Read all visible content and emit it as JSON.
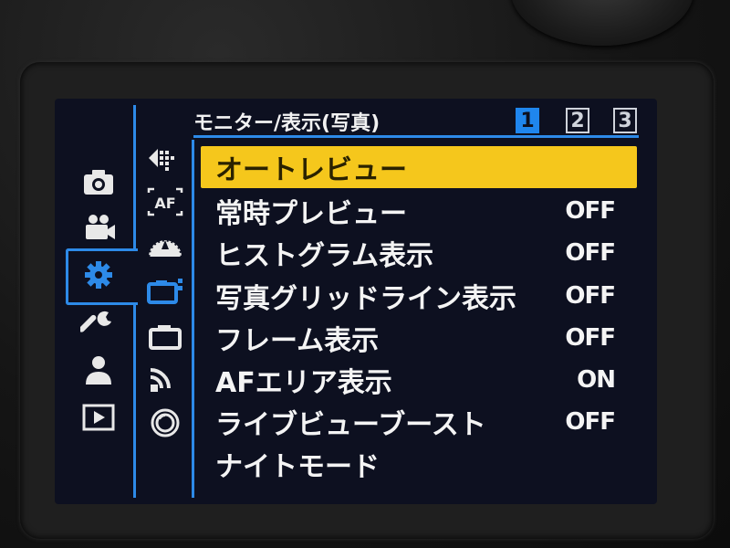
{
  "header": {
    "title": "モニター/表示(写真)",
    "pages": [
      "1",
      "2",
      "3"
    ],
    "active_page": "1"
  },
  "categories": [
    {
      "icon": "camera-icon"
    },
    {
      "icon": "video-camera-icon"
    },
    {
      "icon": "gear-icon",
      "selected": true
    },
    {
      "icon": "wrench-icon"
    },
    {
      "icon": "person-icon"
    },
    {
      "icon": "playback-icon"
    }
  ],
  "tabs": [
    {
      "icon": "drive-mode-icon"
    },
    {
      "icon": "af-icon",
      "text": "AF"
    },
    {
      "icon": "dial-icon"
    },
    {
      "icon": "photo-monitor-icon",
      "selected": true
    },
    {
      "icon": "camera-frame-icon"
    },
    {
      "icon": "wireless-icon"
    },
    {
      "icon": "lens-icon"
    }
  ],
  "menu": {
    "items": [
      {
        "label": "オートレビュー",
        "value": "",
        "selected": true
      },
      {
        "label": "常時プレビュー",
        "value": "OFF"
      },
      {
        "label": "ヒストグラム表示",
        "value": "OFF"
      },
      {
        "label": "写真グリッドライン表示",
        "value": "OFF"
      },
      {
        "label": "フレーム表示",
        "value": "OFF"
      },
      {
        "label": "AFエリア表示",
        "value": "ON"
      },
      {
        "label": "ライブビューブースト",
        "value": "OFF"
      },
      {
        "label": "ナイトモード",
        "value": ""
      }
    ]
  },
  "colors": {
    "accent": "#2d8ae8",
    "highlight": "#f5c71c",
    "text": "#f4f4f4",
    "screen_bg": "#0d1020"
  }
}
